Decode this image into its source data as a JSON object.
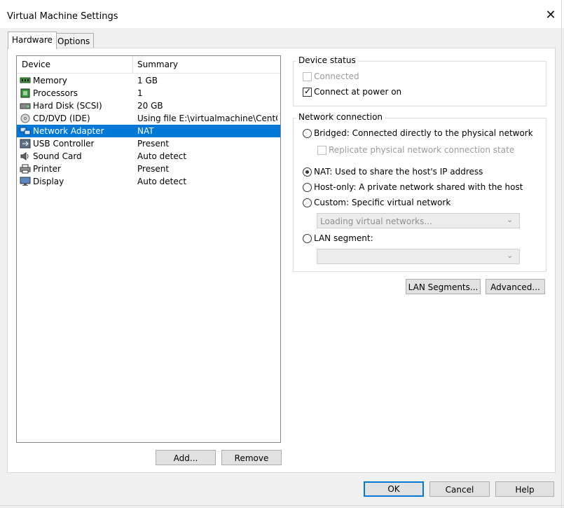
{
  "window": {
    "title": "Virtual Machine Settings",
    "close_glyph": "✕"
  },
  "tabs": [
    {
      "label": "Hardware"
    },
    {
      "label": "Options"
    }
  ],
  "device_list": {
    "columns": {
      "device": "Device",
      "summary": "Summary"
    },
    "rows": [
      {
        "device": "Memory",
        "summary": "1 GB",
        "icon": "memory-icon"
      },
      {
        "device": "Processors",
        "summary": "1",
        "icon": "processor-icon"
      },
      {
        "device": "Hard Disk (SCSI)",
        "summary": "20 GB",
        "icon": "hard-disk-icon"
      },
      {
        "device": "CD/DVD (IDE)",
        "summary": "Using file E:\\virtualmachine\\CentO...",
        "icon": "cd-dvd-icon"
      },
      {
        "device": "Network Adapter",
        "summary": "NAT",
        "icon": "network-adapter-icon",
        "selected": true
      },
      {
        "device": "USB Controller",
        "summary": "Present",
        "icon": "usb-icon"
      },
      {
        "device": "Sound Card",
        "summary": "Auto detect",
        "icon": "speaker-icon"
      },
      {
        "device": "Printer",
        "summary": "Present",
        "icon": "printer-icon"
      },
      {
        "device": "Display",
        "summary": "Auto detect",
        "icon": "monitor-icon"
      }
    ]
  },
  "list_buttons": {
    "add": "Add...",
    "remove": "Remove"
  },
  "device_status": {
    "title": "Device status",
    "connected": {
      "label": "Connected",
      "checked": false,
      "enabled": false
    },
    "connect_at_power_on": {
      "label": "Connect at power on",
      "checked": true,
      "enabled": true
    }
  },
  "network_connection": {
    "title": "Network connection",
    "bridged": "Bridged: Connected directly to the physical network",
    "replicate": "Replicate physical network connection state",
    "nat": "NAT: Used to share the host's IP address",
    "host_only": "Host-only: A private network shared with the host",
    "custom": "Custom: Specific virtual network",
    "custom_combo_text": "Loading virtual networks...",
    "lan_segment": "LAN segment:",
    "lan_combo_text": "",
    "selected_option": "nat"
  },
  "network_buttons": {
    "lan_segments": "LAN Segments...",
    "advanced": "Advanced..."
  },
  "footer": {
    "ok": "OK",
    "cancel": "Cancel",
    "help": "Help"
  },
  "colors": {
    "selection": "#0078d7",
    "dialog_bg": "#f0f0f0",
    "default_button_border": "#0078d7"
  }
}
